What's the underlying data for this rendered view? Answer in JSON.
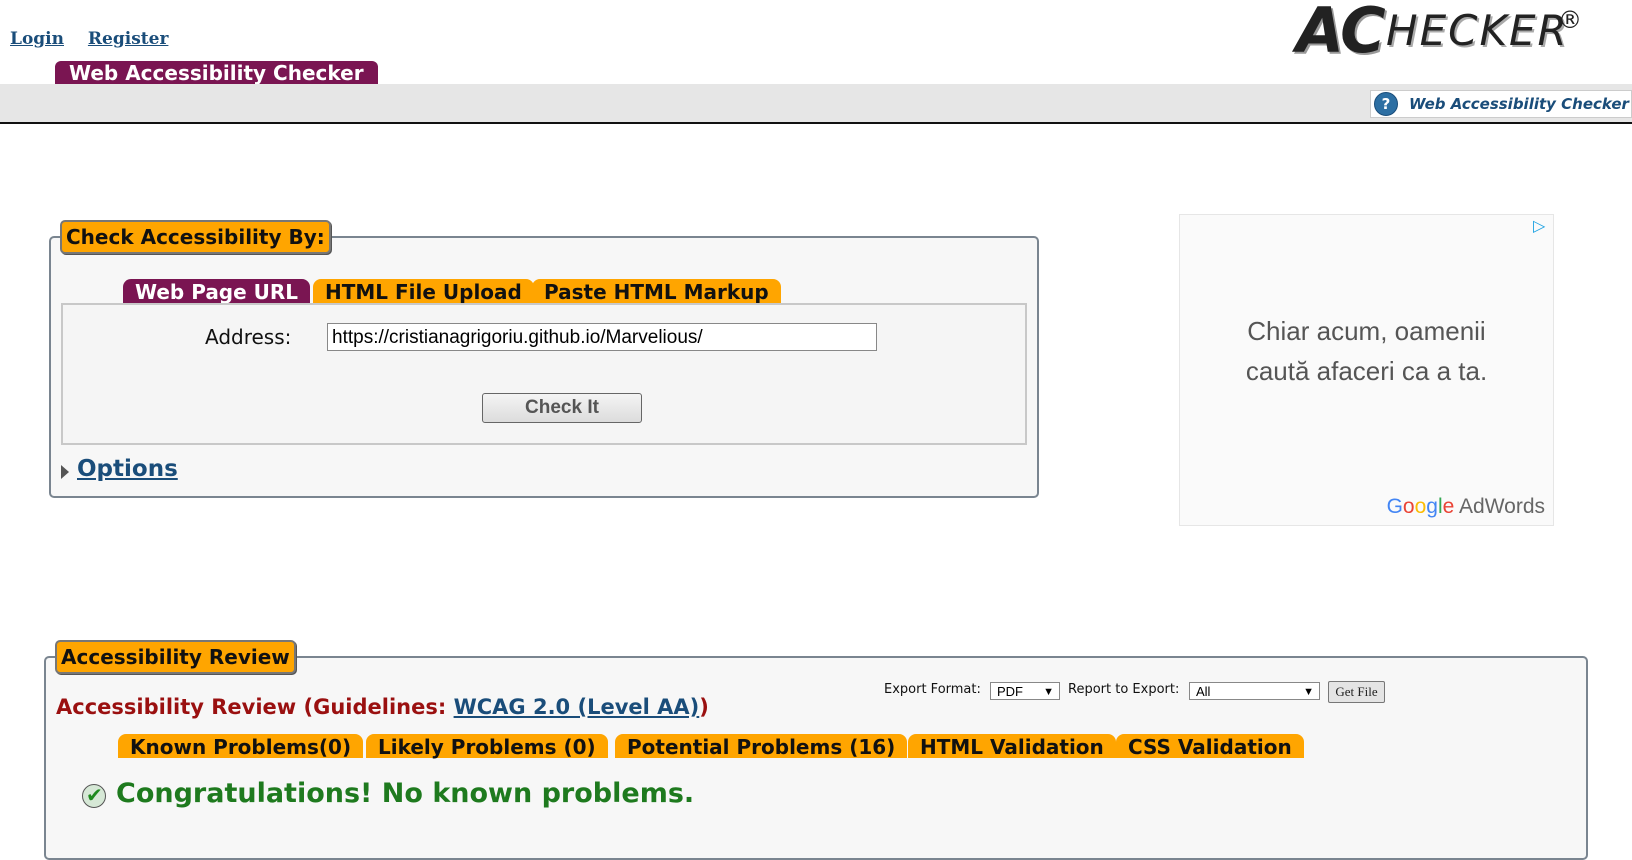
{
  "header": {
    "login_label": "Login",
    "register_label": "Register",
    "logo_ac": "AC",
    "logo_checker": "HECKER",
    "logo_reg": "®",
    "site_tab": "Web Accessibility Checker",
    "help_text": "Web Accessibility Checker",
    "help_icon": "?"
  },
  "check_panel": {
    "legend": "Check Accessibility By:",
    "tabs": [
      {
        "label": "Web Page URL",
        "active": true
      },
      {
        "label": "HTML File Upload",
        "active": false
      },
      {
        "label": "Paste HTML Markup",
        "active": false
      }
    ],
    "address_label": "Address:",
    "address_value": "https://cristianagrigoriu.github.io/Marvelious/",
    "check_button": "Check It",
    "options_label": "Options"
  },
  "ad": {
    "line1": "Chiar acum, oamenii",
    "line2": "caută afaceri ca a ta.",
    "brand_g": "G",
    "brand_o1": "o",
    "brand_o2": "o",
    "brand_g2": "g",
    "brand_l": "l",
    "brand_e": "e",
    "brand_adwords": " AdWords",
    "icon": "adchoices-icon"
  },
  "review_panel": {
    "legend": "Accessibility Review",
    "title_prefix": "Accessibility Review (Guidelines: ",
    "guideline_link": "WCAG 2.0 (Level AA)",
    "title_suffix": ")",
    "export_format_label": "Export Format:",
    "export_format_value": "PDF",
    "report_label": "Report to Export:",
    "report_value": "All",
    "get_file_button": "Get File",
    "tabs": [
      {
        "label": "Known Problems(0)"
      },
      {
        "label": "Likely Problems (0)"
      },
      {
        "label": "Potential Problems (16)"
      },
      {
        "label": "HTML Validation"
      },
      {
        "label": "CSS Validation"
      }
    ],
    "congrats": "Congratulations! No known problems."
  },
  "colors": {
    "accent_purple": "#7a1552",
    "tab_orange": "#ffa500",
    "link_blue": "#1a4d7a",
    "success_green": "#1e7a1e",
    "title_red": "#9a1010"
  }
}
